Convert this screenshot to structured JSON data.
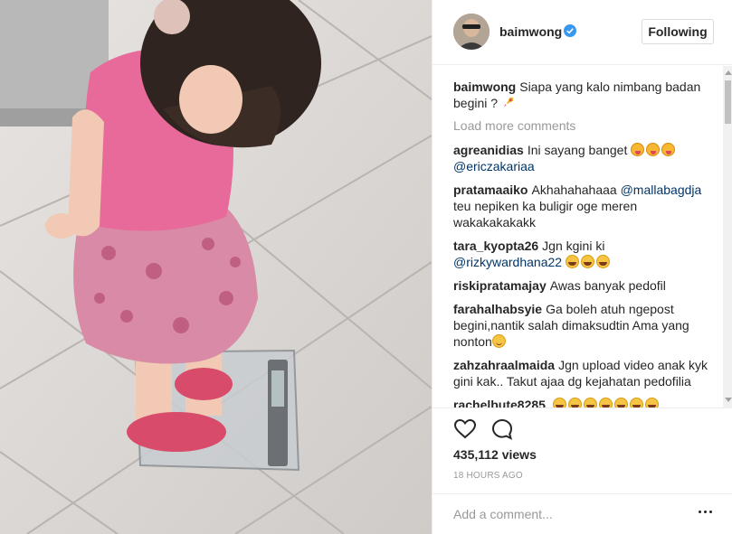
{
  "post": {
    "username": "baimwong",
    "follow_label": "Following",
    "caption_user": "baimwong",
    "caption_text": "Siapa yang kalo nimbang badan begini ?",
    "load_more": "Load more comments",
    "views": "435,112 views",
    "timestamp": "18 HOURS AGO",
    "add_comment_placeholder": "Add a comment..."
  },
  "comments": [
    {
      "user": "agreanidias",
      "text": "Ini sayang banget",
      "mention": "@ericzakariaa",
      "emoji": "tongue"
    },
    {
      "user": "pratamaaiko",
      "text": "Akhahahahaaa",
      "mention": "@mallabagdja",
      "text2": "teu nepiken ka buligir oge meren wakakakakakk"
    },
    {
      "user": "tara_kyopta26",
      "text": "Jgn kgini ki",
      "mention": "@rizkywardhana22",
      "emoji": "laugh"
    },
    {
      "user": "riskipratamajay",
      "text": "Awas banyak pedofil"
    },
    {
      "user": "farahalhabsyie",
      "text": "Ga boleh atuh ngepost begini,nantik salah dimaksudtin Ama yang nonton",
      "emoji": "smile"
    },
    {
      "user": "zahzahraalmaida",
      "text": "Jgn upload video anak kyk gini kak.. Takut ajaa dg kejahatan pedofilia"
    },
    {
      "user": "rachelbute8285",
      "emoji": "laugh"
    }
  ],
  "icons": {
    "verified": "verified-badge-icon",
    "like": "heart-icon",
    "comment": "speech-bubble-icon",
    "more": "more-options-icon"
  },
  "colors": {
    "accent": "#3897f0",
    "mention": "#003569",
    "muted": "#999999",
    "border": "#efefef"
  }
}
